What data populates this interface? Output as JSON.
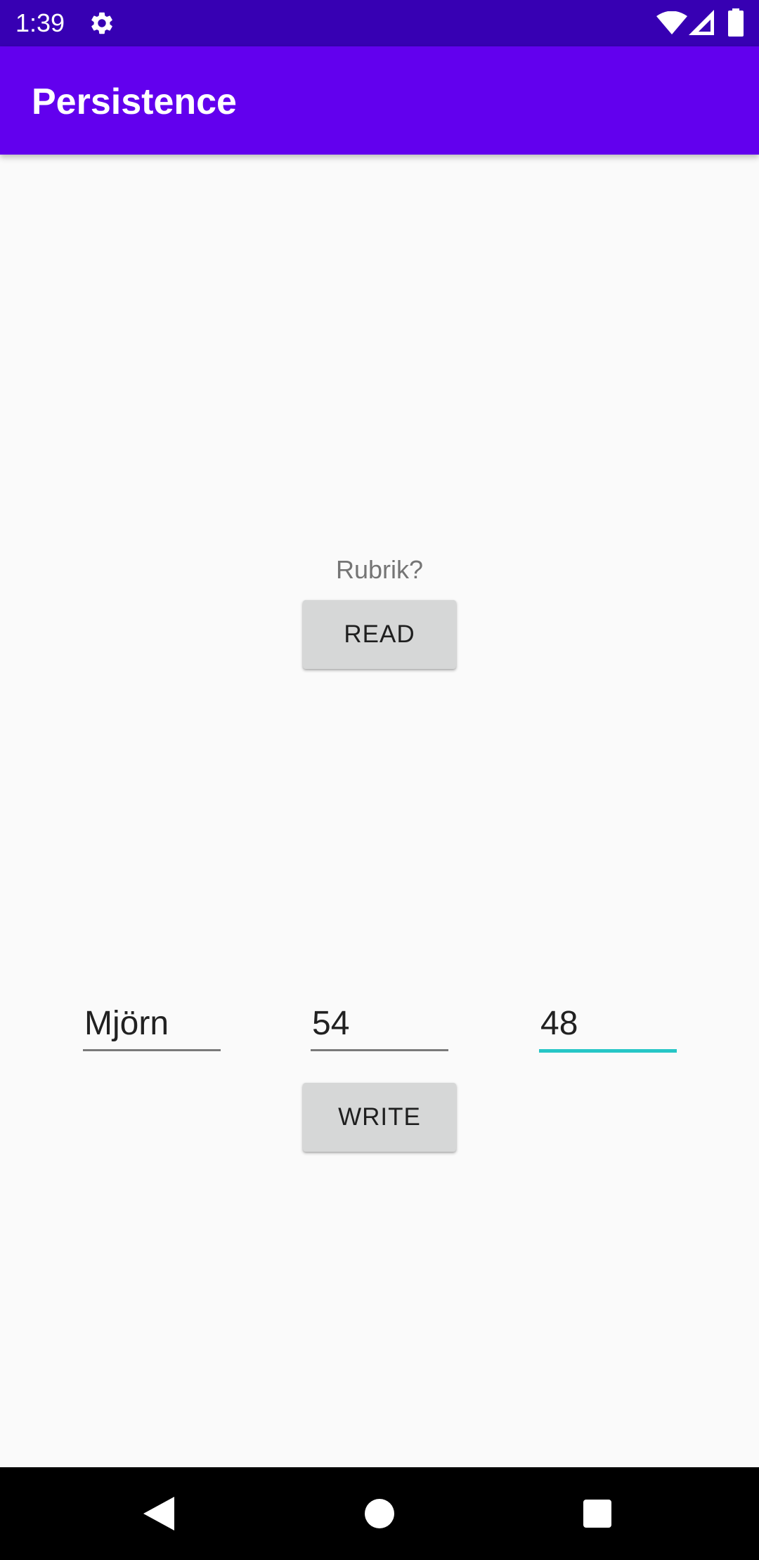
{
  "status_bar": {
    "time": "1:39",
    "icons": [
      "gear-icon",
      "wifi-icon",
      "signal-icon",
      "battery-icon"
    ],
    "background": "#3700b3"
  },
  "app_bar": {
    "title": "Persistence",
    "background": "#6200ee"
  },
  "main": {
    "heading": "Rubrik?",
    "read_button_label": "READ",
    "write_button_label": "WRITE",
    "fields": {
      "name_value": "Mjörn",
      "first_number_value": "54",
      "second_number_value": "48"
    },
    "focus_accent": "#26c6c6"
  },
  "nav_bar": {
    "icons": [
      "back-icon",
      "home-icon",
      "recent-apps-icon"
    ]
  }
}
